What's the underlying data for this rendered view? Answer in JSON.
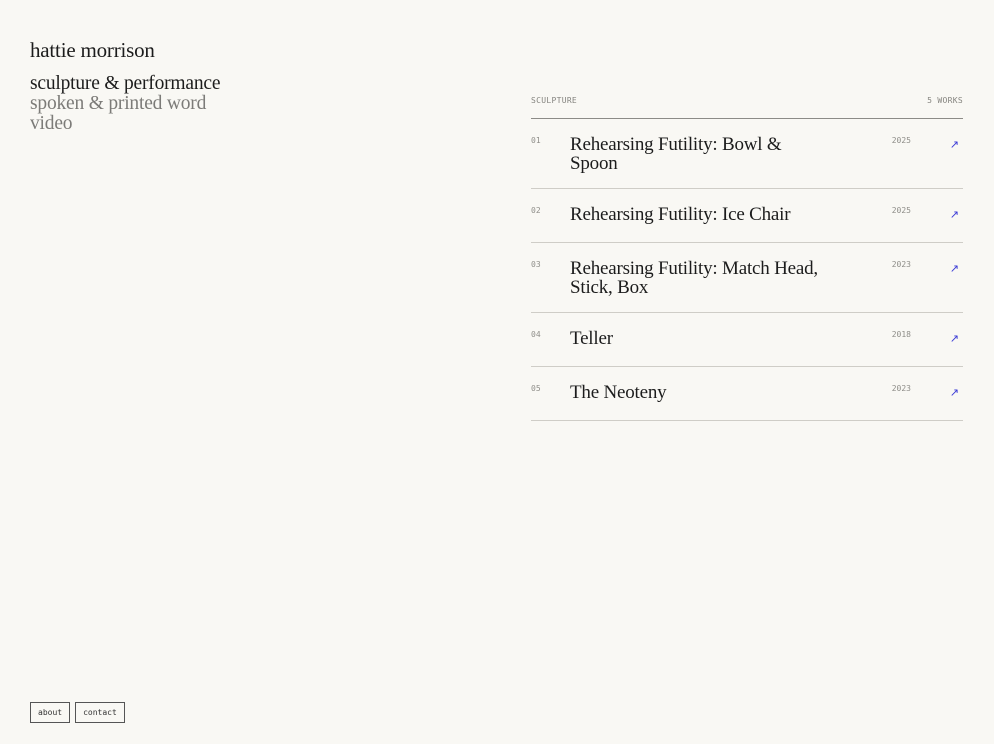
{
  "site": {
    "name": "hattie morrison"
  },
  "nav": {
    "items": [
      {
        "label": "sculpture & performance",
        "active": true
      },
      {
        "label": "spoken & printed word",
        "active": false
      },
      {
        "label": "video",
        "active": false
      }
    ]
  },
  "works": {
    "section_label": "SCULPTURE",
    "count_label": "5 WORKS",
    "items": [
      {
        "num": "01",
        "title": "Rehearsing Futility: Bowl & Spoon",
        "year": "2025",
        "arrow": "↗"
      },
      {
        "num": "02",
        "title": "Rehearsing Futility: Ice Chair",
        "year": "2025",
        "arrow": "↗"
      },
      {
        "num": "03",
        "title": "Rehearsing Futility: Match Head, Stick, Box",
        "year": "2023",
        "arrow": "↗"
      },
      {
        "num": "04",
        "title": "Teller",
        "year": "2018",
        "arrow": "↗"
      },
      {
        "num": "05",
        "title": "The Neoteny",
        "year": "2023",
        "arrow": "↗"
      }
    ]
  },
  "footer": {
    "about_label": "about",
    "contact_label": "contact"
  },
  "colors": {
    "background": "#f9f8f4",
    "text": "#1c1c1c",
    "muted": "#7c7b78",
    "accent": "#3b3bd6"
  },
  "icons": {
    "external_link": "arrow-up-right-icon"
  }
}
